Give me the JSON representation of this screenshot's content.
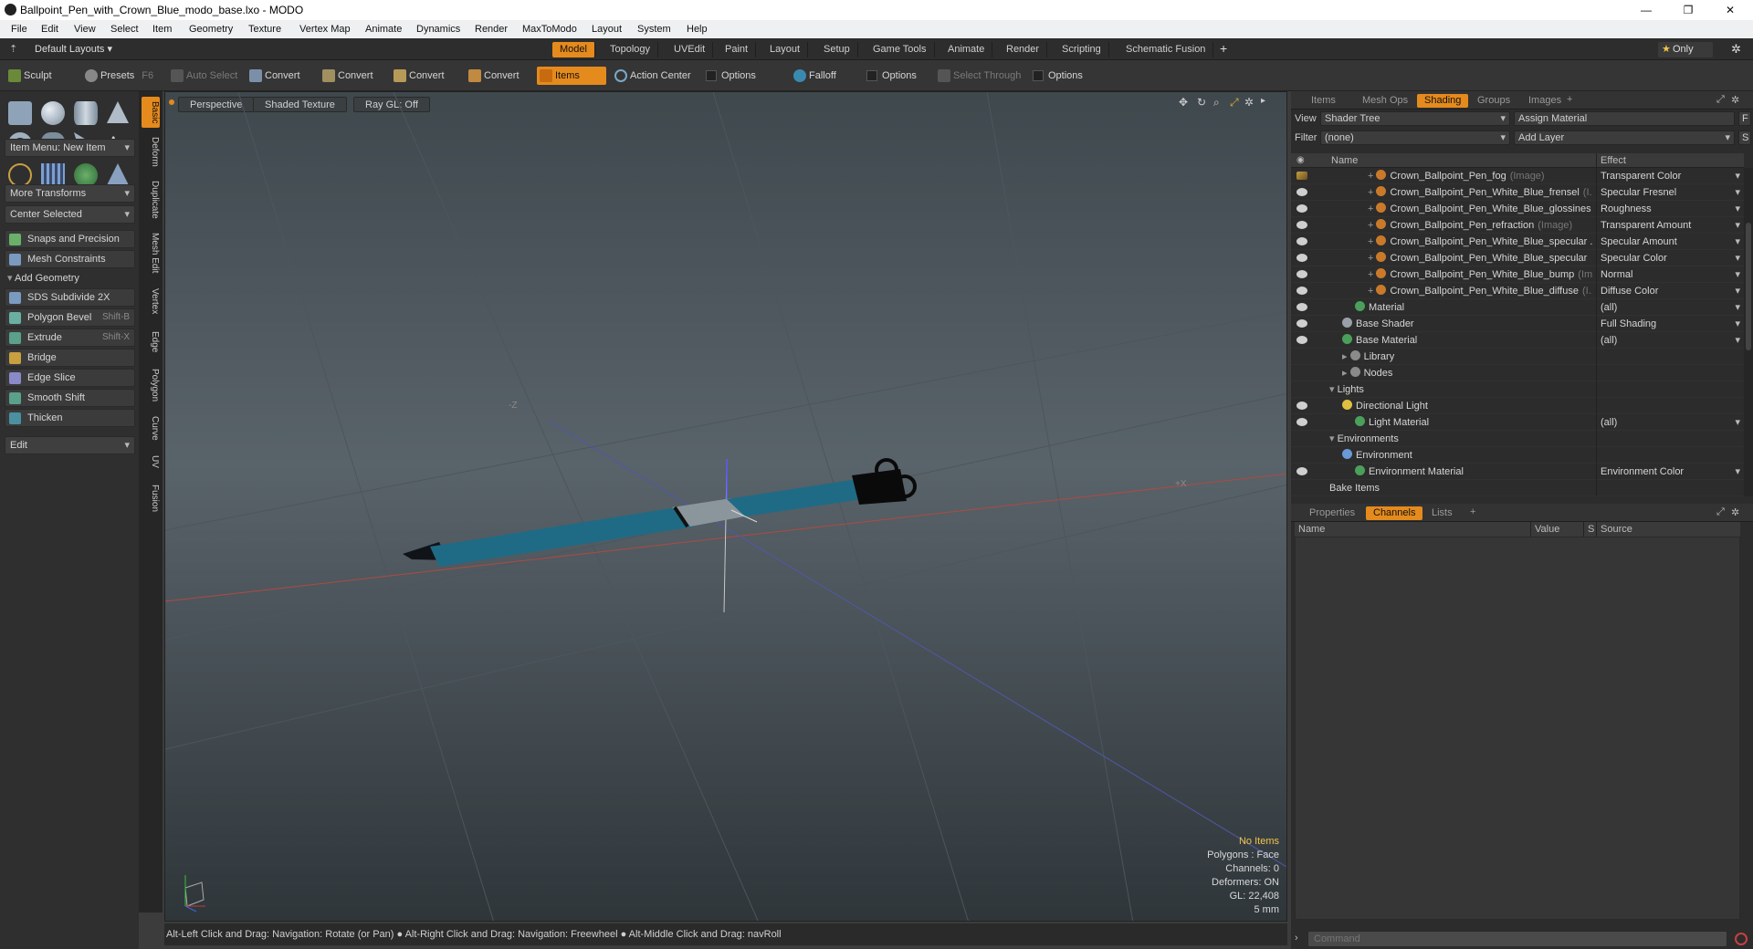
{
  "window": {
    "title": "Ballpoint_Pen_with_Crown_Blue_modo_base.lxo - MODO",
    "minimize": "—",
    "restore": "❐",
    "close": "✕"
  },
  "menu": [
    "File",
    "Edit",
    "View",
    "Select",
    "Item",
    "Geometry",
    "Texture",
    "Vertex Map",
    "Animate",
    "Dynamics",
    "Render",
    "MaxToModo",
    "Layout",
    "System",
    "Help"
  ],
  "layoutbar": {
    "layouts_label": "Default Layouts",
    "tabs": [
      "Model",
      "Topology",
      "UVEdit",
      "Paint",
      "Layout",
      "Setup",
      "Game Tools",
      "Animate",
      "Render",
      "Scripting",
      "Schematic Fusion"
    ],
    "active_tab": "Model",
    "add": "+",
    "only_label": "Only"
  },
  "toolbar": {
    "sculpt": "Sculpt",
    "presets": "Presets",
    "presets_key": "F6",
    "auto_select": "Auto Select",
    "convert1": "Convert",
    "convert2": "Convert",
    "convert3": "Convert",
    "convert4": "Convert",
    "items": "Items",
    "action_center": "Action Center",
    "options1": "Options",
    "falloff": "Falloff",
    "options2": "Options",
    "select_through": "Select Through",
    "options3": "Options"
  },
  "leftpanel": {
    "item_menu": "Item Menu: New Item",
    "more_transforms": "More Transforms",
    "center_selected": "Center Selected",
    "snaps": "Snaps and Precision",
    "mesh_constraints": "Mesh Constraints",
    "add_geometry": "Add Geometry",
    "tools": [
      {
        "label": "SDS Subdivide 2X",
        "shortcut": ""
      },
      {
        "label": "Polygon Bevel",
        "shortcut": "Shift-B"
      },
      {
        "label": "Extrude",
        "shortcut": "Shift-X"
      },
      {
        "label": "Bridge",
        "shortcut": ""
      },
      {
        "label": "Edge Slice",
        "shortcut": ""
      },
      {
        "label": "Smooth Shift",
        "shortcut": ""
      },
      {
        "label": "Thicken",
        "shortcut": ""
      }
    ],
    "edit": "Edit",
    "vtabs": [
      "Basic",
      "Deform",
      "Duplicate",
      "Mesh Edit",
      "Vertex",
      "Edge",
      "Polygon",
      "Curve",
      "UV",
      "Fusion"
    ]
  },
  "viewport": {
    "perspective": "Perspective",
    "shading": "Shaded Texture",
    "raygl": "Ray GL: Off",
    "axis_z": "-Z",
    "axis_x": "+X",
    "info": {
      "items": "No Items",
      "polygons": "Polygons : Face",
      "channels": "Channels: 0",
      "deformers": "Deformers: ON",
      "gl": "GL: 22,408",
      "scale": "5 mm"
    }
  },
  "statusbar": "Alt-Left Click and Drag: Navigation: Rotate (or Pan) ● Alt-Right Click and Drag: Navigation: Freewheel ● Alt-Middle Click and Drag: navRoll",
  "rightpanel": {
    "tabs": [
      "Items",
      "Mesh Ops",
      "Shading",
      "Groups",
      "Images"
    ],
    "active_tab": "Shading",
    "view_label": "View",
    "view_value": "Shader Tree",
    "assign_material": "Assign Material",
    "filter_label": "Filter",
    "filter_value": "(none)",
    "add_layer": "Add Layer",
    "f_btn": "F",
    "s_btn": "S",
    "col_name": "Name",
    "col_effect": "Effect",
    "rows": [
      {
        "name": "Crown_Ballpoint_Pen_fog",
        "tag": "(Image)",
        "effect": "Transparent Color",
        "indent": 4,
        "type": "img",
        "eye": "brush"
      },
      {
        "name": "Crown_Ballpoint_Pen_White_Blue_frensel",
        "tag": "(I...",
        "effect": "Specular Fresnel",
        "indent": 4,
        "type": "img",
        "eye": "eye"
      },
      {
        "name": "Crown_Ballpoint_Pen_White_Blue_glossines ...",
        "tag": "",
        "effect": "Roughness",
        "indent": 4,
        "type": "img",
        "eye": "eye"
      },
      {
        "name": "Crown_Ballpoint_Pen_refraction",
        "tag": "(Image)",
        "effect": "Transparent Amount",
        "indent": 4,
        "type": "img",
        "eye": "eye"
      },
      {
        "name": "Crown_Ballpoint_Pen_White_Blue_specular ...",
        "tag": "",
        "effect": "Specular Amount",
        "indent": 4,
        "type": "img",
        "eye": "eye"
      },
      {
        "name": "Crown_Ballpoint_Pen_White_Blue_specular",
        "tag": "",
        "effect": "Specular Color",
        "indent": 4,
        "type": "img",
        "eye": "eye"
      },
      {
        "name": "Crown_Ballpoint_Pen_White_Blue_bump",
        "tag": "(Im...",
        "effect": "Normal",
        "indent": 4,
        "type": "img",
        "eye": "eye"
      },
      {
        "name": "Crown_Ballpoint_Pen_White_Blue_diffuse",
        "tag": "(I...",
        "effect": "Diffuse Color",
        "indent": 4,
        "type": "img",
        "eye": "eye"
      },
      {
        "name": "Material",
        "tag": "",
        "effect": "(all)",
        "indent": 3,
        "type": "mat",
        "eye": "eye"
      },
      {
        "name": "Base Shader",
        "tag": "",
        "effect": "Full Shading",
        "indent": 2,
        "type": "shader",
        "eye": "eye"
      },
      {
        "name": "Base Material",
        "tag": "",
        "effect": "(all)",
        "indent": 2,
        "type": "mat",
        "eye": "eye"
      },
      {
        "name": "Library",
        "tag": "",
        "effect": "",
        "indent": 2,
        "type": "folder",
        "eye": ""
      },
      {
        "name": "Nodes",
        "tag": "",
        "effect": "",
        "indent": 2,
        "type": "folder",
        "eye": ""
      },
      {
        "name": "Lights",
        "tag": "",
        "effect": "",
        "indent": 1,
        "type": "group",
        "eye": ""
      },
      {
        "name": "Directional Light",
        "tag": "",
        "effect": "",
        "indent": 2,
        "type": "light",
        "eye": "eye"
      },
      {
        "name": "Light Material",
        "tag": "",
        "effect": "(all)",
        "indent": 3,
        "type": "mat",
        "eye": "eye"
      },
      {
        "name": "Environments",
        "tag": "",
        "effect": "",
        "indent": 1,
        "type": "group",
        "eye": ""
      },
      {
        "name": "Environment",
        "tag": "",
        "effect": "",
        "indent": 2,
        "type": "env",
        "eye": ""
      },
      {
        "name": "Environment Material",
        "tag": "",
        "effect": "Environment Color",
        "indent": 3,
        "type": "mat",
        "eye": "eye"
      },
      {
        "name": "Bake Items",
        "tag": "",
        "effect": "",
        "indent": 1,
        "type": "none",
        "eye": ""
      }
    ],
    "bottom_tabs": [
      "Properties",
      "Channels",
      "Lists"
    ],
    "bottom_active": "Channels",
    "chan_cols": [
      "Name",
      "Value",
      "S",
      "Source"
    ],
    "command_placeholder": "Command"
  },
  "colors": {
    "accent": "#e58a1c",
    "pen_body": "#1f6b86",
    "pen_band": "#8a959c",
    "crown": "#0a0a0a"
  }
}
